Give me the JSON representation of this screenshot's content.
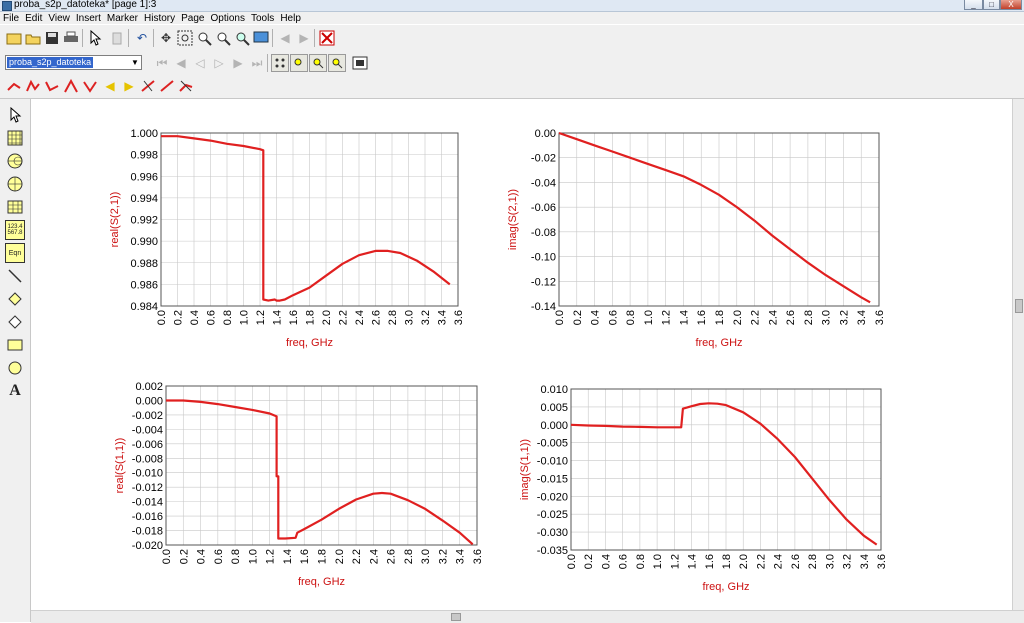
{
  "window": {
    "title": "proba_s2p_datoteka* [page 1]:3",
    "controls": [
      "_",
      "□",
      "X"
    ]
  },
  "menu": [
    "File",
    "Edit",
    "View",
    "Insert",
    "Marker",
    "History",
    "Page",
    "Options",
    "Tools",
    "Help"
  ],
  "toolbar1_icons": [
    "new-icon",
    "open-icon",
    "save-icon",
    "print-icon",
    "select-pointer-icon",
    "delete-icon",
    "undo-icon",
    "move-icon",
    "zoom-area-icon",
    "zoom-in-icon",
    "zoom-out-icon",
    "zoom-fit-icon",
    "screen-icon",
    "page-back-icon",
    "page-forward-icon",
    "stop-icon"
  ],
  "page_select": {
    "value": "proba_s2p_datoteka"
  },
  "toolbar2_icons": [
    "first-page-icon",
    "prev-page-icon",
    "prev-icon",
    "next-icon",
    "next-page-icon",
    "last-page-icon",
    "view-all-icon",
    "zoom-box-icon",
    "zoom-plus-icon",
    "zoom-minus-icon",
    "fit-window-icon"
  ],
  "toolbar3_icons": [
    "marker-new-icon",
    "marker-peak-icon",
    "marker-valley-icon",
    "marker-max-icon",
    "marker-min-icon",
    "marker-left-icon",
    "marker-right-icon",
    "marker-delta-icon",
    "marker-line-icon",
    "marker-off-icon"
  ],
  "sidebar_icons": [
    "pointer-icon",
    "table-plot-icon",
    "smith-chart-icon",
    "polar-plot-icon",
    "list-grid-icon",
    "numeric-table-icon",
    "equation-icon",
    "line-tool-icon",
    "polyline-icon",
    "polygon-icon",
    "rectangle-icon",
    "circle-icon",
    "text-tool-icon"
  ],
  "sidebar_labels": {
    "numeric": "123.4\n567.8",
    "equation": "Eqn",
    "text": "A"
  },
  "colors": {
    "trace": "#e02020",
    "axis_text": "#cc1111",
    "grid": "#c8c8c8"
  },
  "chart_data": [
    {
      "type": "line",
      "xlabel": "freq, GHz",
      "ylabel": "real(S(2,1))",
      "xlim": [
        0.0,
        3.6
      ],
      "ylim": [
        0.984,
        1.0
      ],
      "xticks": [
        "0.0",
        "0.2",
        "0.4",
        "0.6",
        "0.8",
        "1.0",
        "1.2",
        "1.4",
        "1.6",
        "1.8",
        "2.0",
        "2.2",
        "2.4",
        "2.6",
        "2.8",
        "3.0",
        "3.2",
        "3.4",
        "3.6"
      ],
      "yticks": [
        "0.984",
        "0.986",
        "0.988",
        "0.990",
        "0.992",
        "0.994",
        "0.996",
        "0.998",
        "1.000"
      ],
      "x": [
        0.0,
        0.1,
        0.2,
        0.4,
        0.6,
        0.8,
        1.0,
        1.2,
        1.24,
        1.24,
        1.3,
        1.38,
        1.4,
        1.44,
        1.5,
        1.6,
        1.8,
        2.0,
        2.2,
        2.4,
        2.6,
        2.75,
        2.9,
        3.1,
        3.3,
        3.5
      ],
      "y": [
        0.9997,
        0.9997,
        0.9997,
        0.9995,
        0.9993,
        0.999,
        0.9988,
        0.9985,
        0.9984,
        0.9846,
        0.9845,
        0.9846,
        0.9845,
        0.9845,
        0.9846,
        0.985,
        0.9857,
        0.9868,
        0.9879,
        0.9887,
        0.9891,
        0.9891,
        0.9889,
        0.9882,
        0.9872,
        0.986
      ]
    },
    {
      "type": "line",
      "xlabel": "freq, GHz",
      "ylabel": "imag(S(2,1))",
      "xlim": [
        0.0,
        3.6
      ],
      "ylim": [
        -0.14,
        0.0
      ],
      "xticks": [
        "0.0",
        "0.2",
        "0.4",
        "0.6",
        "0.8",
        "1.0",
        "1.2",
        "1.4",
        "1.6",
        "1.8",
        "2.0",
        "2.2",
        "2.4",
        "2.6",
        "2.8",
        "3.0",
        "3.2",
        "3.4",
        "3.6"
      ],
      "yticks": [
        "-0.14",
        "-0.12",
        "-0.10",
        "-0.08",
        "-0.06",
        "-0.04",
        "-0.02",
        "0.00"
      ],
      "x": [
        0.0,
        0.2,
        0.4,
        0.6,
        0.8,
        1.0,
        1.2,
        1.4,
        1.6,
        1.8,
        2.0,
        2.2,
        2.4,
        2.6,
        2.8,
        3.0,
        3.2,
        3.4,
        3.5
      ],
      "y": [
        0.0,
        -0.005,
        -0.01,
        -0.015,
        -0.02,
        -0.025,
        -0.03,
        -0.035,
        -0.042,
        -0.05,
        -0.06,
        -0.071,
        -0.083,
        -0.094,
        -0.105,
        -0.115,
        -0.124,
        -0.133,
        -0.137
      ]
    },
    {
      "type": "line",
      "xlabel": "freq, GHz",
      "ylabel": "real(S(1,1))",
      "xlim": [
        0.0,
        3.6
      ],
      "ylim": [
        -0.02,
        0.002
      ],
      "xticks": [
        "0.0",
        "0.2",
        "0.4",
        "0.6",
        "0.8",
        "1.0",
        "1.2",
        "1.4",
        "1.6",
        "1.8",
        "2.0",
        "2.2",
        "2.4",
        "2.6",
        "2.8",
        "3.0",
        "3.2",
        "3.4",
        "3.6"
      ],
      "yticks": [
        "-0.020",
        "-0.018",
        "-0.016",
        "-0.014",
        "-0.012",
        "-0.010",
        "-0.008",
        "-0.006",
        "-0.004",
        "-0.002",
        "0.000",
        "0.002"
      ],
      "x": [
        0.0,
        0.2,
        0.4,
        0.6,
        0.8,
        1.0,
        1.2,
        1.28,
        1.28,
        1.3,
        1.3,
        1.38,
        1.5,
        1.52,
        1.6,
        1.8,
        2.0,
        2.2,
        2.4,
        2.5,
        2.6,
        2.8,
        3.0,
        3.2,
        3.4,
        3.55
      ],
      "y": [
        0.0,
        0.0,
        -0.0002,
        -0.0005,
        -0.0009,
        -0.0013,
        -0.0018,
        -0.0022,
        -0.0105,
        -0.0105,
        -0.0191,
        -0.0191,
        -0.019,
        -0.0183,
        -0.0178,
        -0.0165,
        -0.015,
        -0.0137,
        -0.0129,
        -0.0128,
        -0.0129,
        -0.0138,
        -0.015,
        -0.0166,
        -0.0183,
        -0.0199
      ]
    },
    {
      "type": "line",
      "xlabel": "freq, GHz",
      "ylabel": "imag(S(1,1))",
      "xlim": [
        0.0,
        3.6
      ],
      "ylim": [
        -0.035,
        0.01
      ],
      "xticks": [
        "0.0",
        "0.2",
        "0.4",
        "0.6",
        "0.8",
        "1.0",
        "1.2",
        "1.4",
        "1.6",
        "1.8",
        "2.0",
        "2.2",
        "2.4",
        "2.6",
        "2.8",
        "3.0",
        "3.2",
        "3.4",
        "3.6"
      ],
      "yticks": [
        "-0.035",
        "-0.030",
        "-0.025",
        "-0.020",
        "-0.015",
        "-0.010",
        "-0.005",
        "0.000",
        "0.005",
        "0.010"
      ],
      "x": [
        0.0,
        0.2,
        0.4,
        0.6,
        0.8,
        1.0,
        1.2,
        1.28,
        1.3,
        1.4,
        1.5,
        1.6,
        1.7,
        1.8,
        2.0,
        2.2,
        2.4,
        2.6,
        2.8,
        3.0,
        3.2,
        3.4,
        3.55
      ],
      "y": [
        0.0,
        -0.0002,
        -0.0003,
        -0.0005,
        -0.0006,
        -0.0007,
        -0.0007,
        -0.0007,
        0.0045,
        0.0052,
        0.0058,
        0.006,
        0.0059,
        0.0055,
        0.0035,
        0.0003,
        -0.004,
        -0.009,
        -0.015,
        -0.021,
        -0.0265,
        -0.031,
        -0.0335
      ]
    }
  ]
}
